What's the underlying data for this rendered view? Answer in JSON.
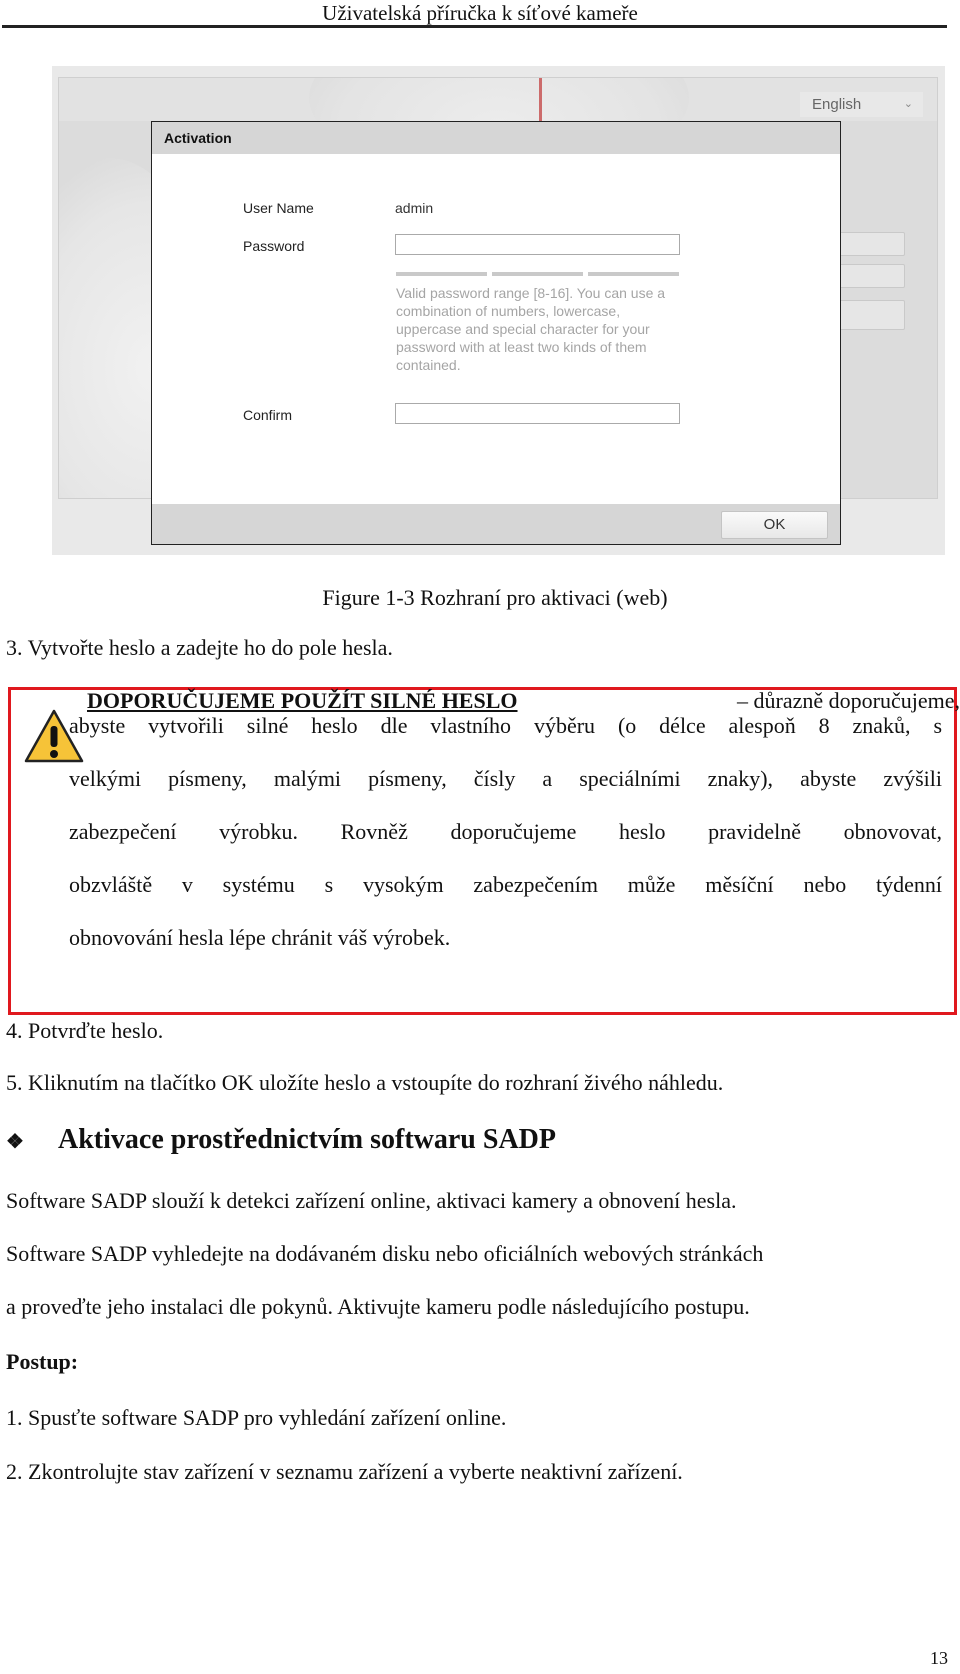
{
  "document": {
    "running_header": "Uživatelská příručka k síťové kameře",
    "page_number": "13"
  },
  "screenshot": {
    "language_select": {
      "value": "English",
      "icon": "chevron-down-icon"
    },
    "dialog": {
      "title": "Activation",
      "fields": {
        "user_name_label": "User Name",
        "user_name_value": "admin",
        "password_label": "Password",
        "password_value": "",
        "confirm_label": "Confirm",
        "confirm_value": ""
      },
      "password_strength_segments": 3,
      "hint_lines": [
        "Valid password range [8-16]. You can use a",
        "combination of numbers, lowercase,",
        "uppercase and special character for your",
        "password with at least two kinds of them",
        "contained."
      ],
      "ok_label": "OK"
    }
  },
  "caption": "Figure 1-3 Rozhraní pro aktivaci (web)",
  "steps_before": {
    "step3": "3. Vytvořte heslo a zadejte ho do pole hesla."
  },
  "warning": {
    "icon": "warning-triangle-icon",
    "title": "DOPORUČUJEME POUŽÍT SILNÉ HESLO",
    "first_line_rest": "– důrazně doporučujeme,",
    "lines": [
      "abyste vytvořili silné heslo dle vlastního výběru (o délce alespoň 8 znaků, s",
      "velkými písmeny, malými písmeny, čísly a speciálními znaky), abyste zvýšili",
      "zabezpečení výrobku. Rovněž doporučujeme heslo pravidelně obnovovat,",
      "obzvláště v systému s vysokým zabezpečením může měsíční nebo týdenní",
      "obnovování hesla lépe chránit váš výrobek."
    ],
    "border_color": "#e0181e"
  },
  "steps_after": {
    "step4": "4. Potvrďte heslo.",
    "step5": "5. Kliknutím na tlačítko OK uložíte heslo a vstoupíte do rozhraní živého náhledu."
  },
  "section": {
    "icon": "diamond-bullet-icon",
    "heading": "Aktivace prostřednictvím softwaru SADP",
    "paragraphs": [
      "Software SADP slouží k detekci zařízení online, aktivaci kamery a obnovení hesla.",
      "Software SADP vyhledejte na dodávaném disku nebo oficiálních webových stránkách",
      "a proveďte jeho instalaci dle pokynů. Aktivujte kameru podle následujícího postupu."
    ],
    "procedure_label": "Postup:",
    "procedure_steps": [
      "1. Spusťte software SADP pro vyhledání zařízení online.",
      "2. Zkontrolujte stav zařízení v seznamu zařízení a vyberte neaktivní zařízení."
    ]
  }
}
